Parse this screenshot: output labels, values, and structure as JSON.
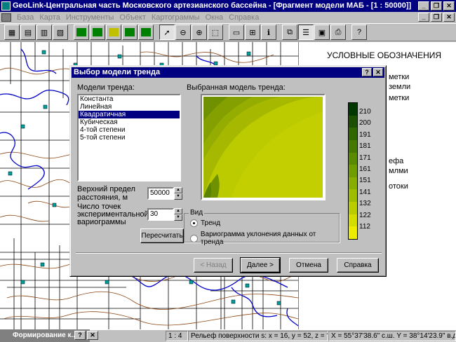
{
  "app": {
    "title": "GeoLink-Центральная часть Московского артезианского бассейна - [Фрагмент модели МАБ - [1 : 50000]]"
  },
  "menu": [
    "База",
    "Карта",
    "Инструменты",
    "Объект",
    "Картограммы",
    "Окна",
    "Справка"
  ],
  "legend": {
    "title": "УСЛОВНЫЕ ОБОЗНАЧЕНИЯ",
    "lines": [
      "метки",
      "земли",
      "метки",
      "ефа",
      "млми",
      "отоки"
    ]
  },
  "dialog": {
    "title": "Выбор модели тренда",
    "models_label": "Модели тренда:",
    "models": [
      "Константа",
      "Линейная",
      "Квадратичная",
      "Кубическая",
      "4-той степени",
      "5-той степени"
    ],
    "selected_index": 2,
    "preview_label": "Выбранная модель тренда:",
    "upper_limit_label": "Верхний предел расстояния, м",
    "upper_limit_value": "50000",
    "points_label": "Число точек экспериментальной вариограммы",
    "points_value": "30",
    "recalc_button": "Пересчитать",
    "view_group_title": "Вид",
    "radio_trend": "Тренд",
    "radio_variogram": "Вариограмма уклонения данных от тренда",
    "back_button": "< Назад",
    "next_button": "Далее >",
    "cancel_button": "Отмена",
    "help_button": "Справка",
    "scale_values": [
      "210",
      "200",
      "191",
      "181",
      "171",
      "161",
      "151",
      "141",
      "132",
      "122",
      "112"
    ],
    "scale_colors": [
      "#003800",
      "#1c5000",
      "#2f6600",
      "#447800",
      "#5a8a00",
      "#6f9c00",
      "#86ad00",
      "#9ebd00",
      "#b8cc00",
      "#d3dd00",
      "#ecec00"
    ]
  },
  "status": {
    "mini_window": "Формирование к...",
    "scale": "1 : 4",
    "surface": "Рельеф поверхности s: x = 16, y = 52, z = ?",
    "coords": "X = 55°37'38.6\" с.ш.  Y = 38°14'23.9\" в.д."
  }
}
